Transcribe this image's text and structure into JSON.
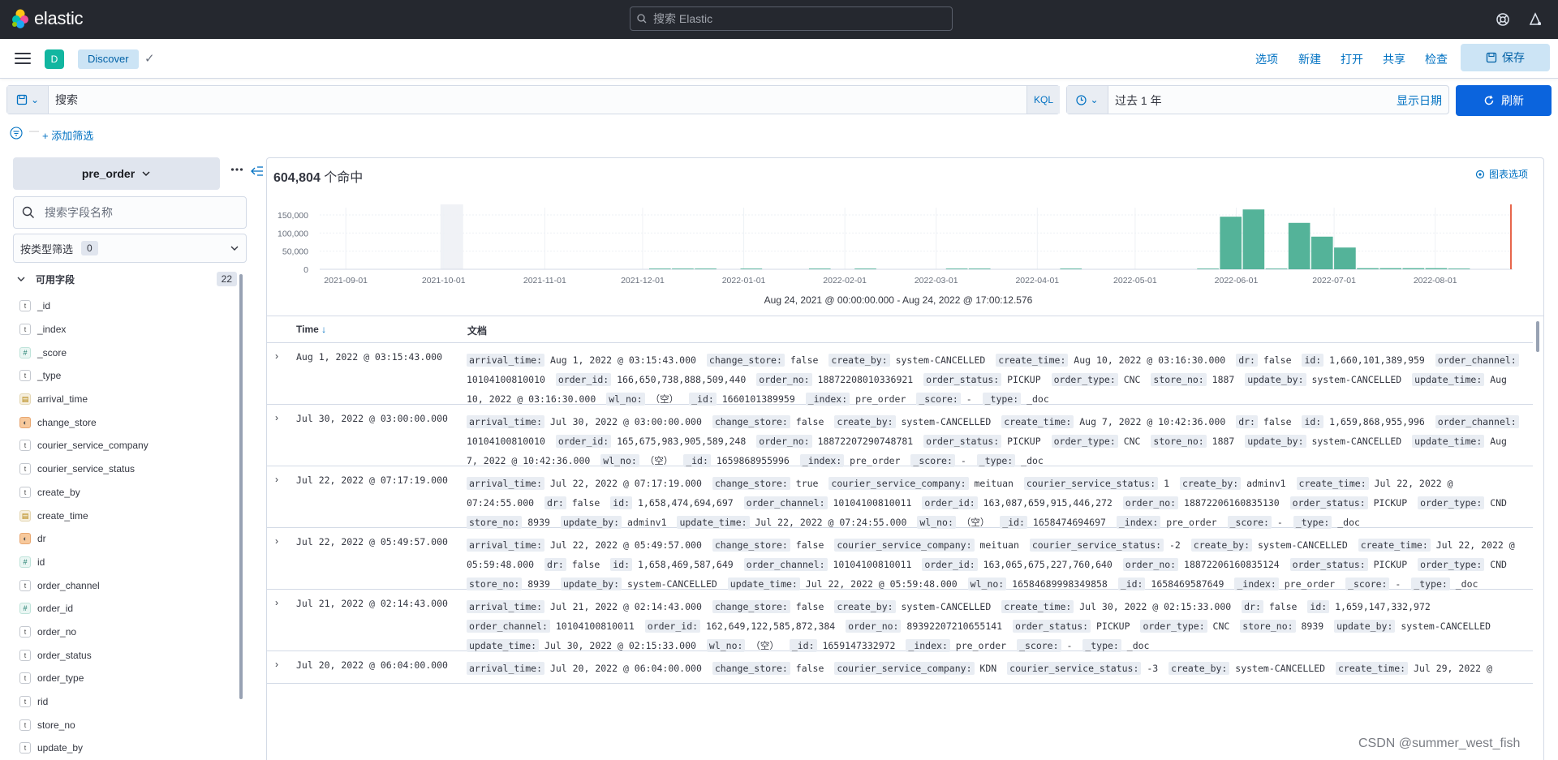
{
  "header": {
    "brand": "elastic",
    "search_placeholder": "搜索 Elastic"
  },
  "appbar": {
    "space_initial": "D",
    "breadcrumb": "Discover",
    "nav": [
      "选项",
      "新建",
      "打开",
      "共享",
      "检查"
    ],
    "save_label": "保存"
  },
  "query": {
    "placeholder": "搜索",
    "language": "KQL"
  },
  "time": {
    "range": "过去 1 年",
    "show_dates": "显示日期",
    "refresh": "刷新"
  },
  "filters": {
    "add_label": "+ 添加筛选"
  },
  "sidebar": {
    "index_pattern": "pre_order",
    "field_search_placeholder": "搜索字段名称",
    "type_filter_label": "按类型筛选",
    "type_filter_count": "0",
    "available_label": "可用字段",
    "available_count": "22",
    "fields": [
      {
        "name": "_id",
        "type": "t"
      },
      {
        "name": "_index",
        "type": "t"
      },
      {
        "name": "_score",
        "type": "#"
      },
      {
        "name": "_type",
        "type": "t"
      },
      {
        "name": "arrival_time",
        "type": "date"
      },
      {
        "name": "change_store",
        "type": "bool"
      },
      {
        "name": "courier_service_company",
        "type": "t"
      },
      {
        "name": "courier_service_status",
        "type": "t"
      },
      {
        "name": "create_by",
        "type": "t"
      },
      {
        "name": "create_time",
        "type": "date"
      },
      {
        "name": "dr",
        "type": "bool"
      },
      {
        "name": "id",
        "type": "#"
      },
      {
        "name": "order_channel",
        "type": "t"
      },
      {
        "name": "order_id",
        "type": "#"
      },
      {
        "name": "order_no",
        "type": "t"
      },
      {
        "name": "order_status",
        "type": "t"
      },
      {
        "name": "order_type",
        "type": "t"
      },
      {
        "name": "rid",
        "type": "t"
      },
      {
        "name": "store_no",
        "type": "t"
      },
      {
        "name": "update_by",
        "type": "t"
      }
    ]
  },
  "results": {
    "hits": "604,804",
    "hits_suffix": " 个命中",
    "chart_options": "图表选项",
    "range_text": "Aug 24, 2021 @ 00:00:00.000 - Aug 24, 2022 @ 17:00:12.576",
    "col_time": "Time",
    "col_doc": "文档"
  },
  "chart_data": {
    "type": "bar",
    "y_ticks": [
      "150,000",
      "100,000",
      "50,000",
      "0"
    ],
    "ylim": [
      0,
      170000
    ],
    "x_ticks": [
      "2021-09-01",
      "2021-10-01",
      "2021-11-01",
      "2021-12-01",
      "2022-01-01",
      "2022-02-01",
      "2022-03-01",
      "2022-04-01",
      "2022-05-01",
      "2022-06-01",
      "2022-07-01",
      "2022-08-01"
    ],
    "bar_color": "#54b399",
    "bars": [
      {
        "x": "2021-12-03",
        "value": 2000
      },
      {
        "x": "2021-12-10",
        "value": 2000
      },
      {
        "x": "2021-12-17",
        "value": 2000
      },
      {
        "x": "2021-12-31",
        "value": 2000
      },
      {
        "x": "2022-01-21",
        "value": 2000
      },
      {
        "x": "2022-02-04",
        "value": 2000
      },
      {
        "x": "2022-03-04",
        "value": 2000
      },
      {
        "x": "2022-03-11",
        "value": 2000
      },
      {
        "x": "2022-04-08",
        "value": 2000
      },
      {
        "x": "2022-05-20",
        "value": 2000
      },
      {
        "x": "2022-05-27",
        "value": 145000
      },
      {
        "x": "2022-06-03",
        "value": 165000
      },
      {
        "x": "2022-06-10",
        "value": 2000
      },
      {
        "x": "2022-06-17",
        "value": 128000
      },
      {
        "x": "2022-06-24",
        "value": 90000
      },
      {
        "x": "2022-07-01",
        "value": 60000
      },
      {
        "x": "2022-07-08",
        "value": 3000
      },
      {
        "x": "2022-07-15",
        "value": 3000
      },
      {
        "x": "2022-07-22",
        "value": 3000
      },
      {
        "x": "2022-07-29",
        "value": 3000
      },
      {
        "x": "2022-08-05",
        "value": 2000
      }
    ]
  },
  "rows": [
    {
      "time": "Aug 1, 2022 @ 03:15:43.000",
      "lines": 3,
      "fields": [
        [
          "arrival_time",
          "Aug 1, 2022 @ 03:15:43.000"
        ],
        [
          "change_store",
          "false"
        ],
        [
          "create_by",
          "system-CANCELLED"
        ],
        [
          "create_time",
          "Aug 10, 2022 @ 03:16:30.000"
        ],
        [
          "dr",
          "false"
        ],
        [
          "id",
          "1,660,101,389,959"
        ],
        [
          "order_channel",
          "10104100810010"
        ],
        [
          "order_id",
          "166,650,738,888,509,440"
        ],
        [
          "order_no",
          "18872208010336921"
        ],
        [
          "order_status",
          "PICKUP"
        ],
        [
          "order_type",
          "CNC"
        ],
        [
          "store_no",
          "1887"
        ],
        [
          "update_by",
          "system-CANCELLED"
        ],
        [
          "update_time",
          "Aug 10, 2022 @ 03:16:30.000"
        ],
        [
          "wl_no",
          "（空）"
        ],
        [
          "_id",
          "1660101389959"
        ],
        [
          "_index",
          "pre_order"
        ],
        [
          "_score",
          " - "
        ],
        [
          "_type",
          "_doc"
        ]
      ]
    },
    {
      "time": "Jul 30, 2022 @ 03:00:00.000",
      "lines": 3,
      "fields": [
        [
          "arrival_time",
          "Jul 30, 2022 @ 03:00:00.000"
        ],
        [
          "change_store",
          "false"
        ],
        [
          "create_by",
          "system-CANCELLED"
        ],
        [
          "create_time",
          "Aug 7, 2022 @ 10:42:36.000"
        ],
        [
          "dr",
          "false"
        ],
        [
          "id",
          "1,659,868,955,996"
        ],
        [
          "order_channel",
          "10104100810010"
        ],
        [
          "order_id",
          "165,675,983,905,589,248"
        ],
        [
          "order_no",
          "18872207290748781"
        ],
        [
          "order_status",
          "PICKUP"
        ],
        [
          "order_type",
          "CNC"
        ],
        [
          "store_no",
          "1887"
        ],
        [
          "update_by",
          "system-CANCELLED"
        ],
        [
          "update_time",
          "Aug 7, 2022 @ 10:42:36.000"
        ],
        [
          "wl_no",
          "（空）"
        ],
        [
          "_id",
          "1659868955996"
        ],
        [
          "_index",
          "pre_order"
        ],
        [
          "_score",
          " - "
        ],
        [
          "_type",
          "_doc"
        ]
      ]
    },
    {
      "time": "Jul 22, 2022 @ 07:17:19.000",
      "lines": 3,
      "fields": [
        [
          "arrival_time",
          "Jul 22, 2022 @ 07:17:19.000"
        ],
        [
          "change_store",
          "true"
        ],
        [
          "courier_service_company",
          "meituan"
        ],
        [
          "courier_service_status",
          "1"
        ],
        [
          "create_by",
          "adminv1"
        ],
        [
          "create_time",
          "Jul 22, 2022 @ 07:24:55.000"
        ],
        [
          "dr",
          "false"
        ],
        [
          "id",
          "1,658,474,694,697"
        ],
        [
          "order_channel",
          "10104100810011"
        ],
        [
          "order_id",
          "163,087,659,915,446,272"
        ],
        [
          "order_no",
          "18872206160835130"
        ],
        [
          "order_status",
          "PICKUP"
        ],
        [
          "order_type",
          "CND"
        ],
        [
          "store_no",
          "8939"
        ],
        [
          "update_by",
          "adminv1"
        ],
        [
          "update_time",
          "Jul 22, 2022 @ 07:24:55.000"
        ],
        [
          "wl_no",
          "（空）"
        ],
        [
          "_id",
          "1658474694697"
        ],
        [
          "_index",
          "pre_order"
        ],
        [
          "_score",
          " - "
        ],
        [
          "_type",
          "_doc"
        ]
      ]
    },
    {
      "time": "Jul 22, 2022 @ 05:49:57.000",
      "lines": 3,
      "fields": [
        [
          "arrival_time",
          "Jul 22, 2022 @ 05:49:57.000"
        ],
        [
          "change_store",
          "false"
        ],
        [
          "courier_service_company",
          "meituan"
        ],
        [
          "courier_service_status",
          "-2"
        ],
        [
          "create_by",
          "system-CANCELLED"
        ],
        [
          "create_time",
          "Jul 22, 2022 @ 05:59:48.000"
        ],
        [
          "dr",
          "false"
        ],
        [
          "id",
          "1,658,469,587,649"
        ],
        [
          "order_channel",
          "10104100810011"
        ],
        [
          "order_id",
          "163,065,675,227,760,640"
        ],
        [
          "order_no",
          "18872206160835124"
        ],
        [
          "order_status",
          "PICKUP"
        ],
        [
          "order_type",
          "CND"
        ],
        [
          "store_no",
          "8939"
        ],
        [
          "update_by",
          "system-CANCELLED"
        ],
        [
          "update_time",
          "Jul 22, 2022 @ 05:59:48.000"
        ],
        [
          "wl_no",
          "16584689998349858"
        ],
        [
          "_id",
          "1658469587649"
        ],
        [
          "_index",
          "pre_order"
        ],
        [
          "_score",
          " - "
        ],
        [
          "_type",
          "_doc"
        ]
      ]
    },
    {
      "time": "Jul 21, 2022 @ 02:14:43.000",
      "lines": 3,
      "fields": [
        [
          "arrival_time",
          "Jul 21, 2022 @ 02:14:43.000"
        ],
        [
          "change_store",
          "false"
        ],
        [
          "create_by",
          "system-CANCELLED"
        ],
        [
          "create_time",
          "Jul 30, 2022 @ 02:15:33.000"
        ],
        [
          "dr",
          "false"
        ],
        [
          "id",
          "1,659,147,332,972"
        ],
        [
          "order_channel",
          "10104100810011"
        ],
        [
          "order_id",
          "162,649,122,585,872,384"
        ],
        [
          "order_no",
          "89392207210655141"
        ],
        [
          "order_status",
          "PICKUP"
        ],
        [
          "order_type",
          "CNC"
        ],
        [
          "store_no",
          "8939"
        ],
        [
          "update_by",
          "system-CANCELLED"
        ],
        [
          "update_time",
          "Jul 30, 2022 @ 02:15:33.000"
        ],
        [
          "wl_no",
          "（空）"
        ],
        [
          "_id",
          "1659147332972"
        ],
        [
          "_index",
          "pre_order"
        ],
        [
          "_score",
          " - "
        ],
        [
          "_type",
          "_doc"
        ]
      ]
    },
    {
      "time": "Jul 20, 2022 @ 06:04:00.000",
      "lines": 1,
      "fields": [
        [
          "arrival_time",
          "Jul 20, 2022 @ 06:04:00.000"
        ],
        [
          "change_store",
          "false"
        ],
        [
          "courier_service_company",
          "KDN"
        ],
        [
          "courier_service_status",
          "-3"
        ],
        [
          "create_by",
          "system-CANCELLED"
        ],
        [
          "create_time",
          "Jul 29, 2022 @"
        ]
      ]
    }
  ],
  "watermark": "CSDN @summer_west_fish"
}
